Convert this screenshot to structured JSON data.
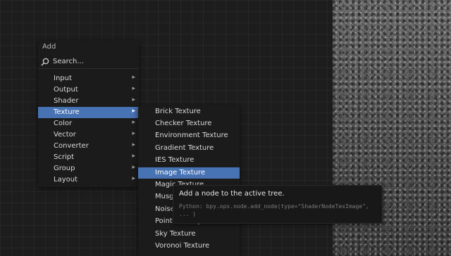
{
  "add_menu": {
    "title": "Add",
    "search_label": "Search...",
    "items": [
      {
        "label": "Input",
        "arrow": "▸"
      },
      {
        "label": "Output",
        "arrow": "▸"
      },
      {
        "label": "Shader",
        "arrow": "▸"
      },
      {
        "label": "Texture",
        "arrow": "▸",
        "active": true
      },
      {
        "label": "Color",
        "arrow": "▸"
      },
      {
        "label": "Vector",
        "arrow": "▸"
      },
      {
        "label": "Converter",
        "arrow": "▸"
      },
      {
        "label": "Script",
        "arrow": "▸"
      },
      {
        "label": "Group",
        "arrow": "▸"
      },
      {
        "label": "Layout",
        "arrow": "▸"
      }
    ]
  },
  "texture_submenu": {
    "items": [
      "Brick Texture",
      "Checker Texture",
      "Environment Texture",
      "Gradient Texture",
      "IES Texture",
      "Image Texture",
      "Magic Texture",
      "Musgrave Texture",
      "Noise Texture",
      "Point Density",
      "Sky Texture",
      "Voronoi Texture"
    ],
    "active_index": 5
  },
  "tooltip": {
    "title": "Add a node to the active tree.",
    "python": "Python: bpy.ops.node.add_node(type=\"ShaderNodeTexImage\", ... )"
  },
  "colors": {
    "accent": "#4772b3",
    "menu_bg": "#1b1b1b",
    "editor_bg": "#1d1d1d"
  },
  "icons": {
    "search": "search-icon",
    "submenu": "chevron-right-icon"
  }
}
